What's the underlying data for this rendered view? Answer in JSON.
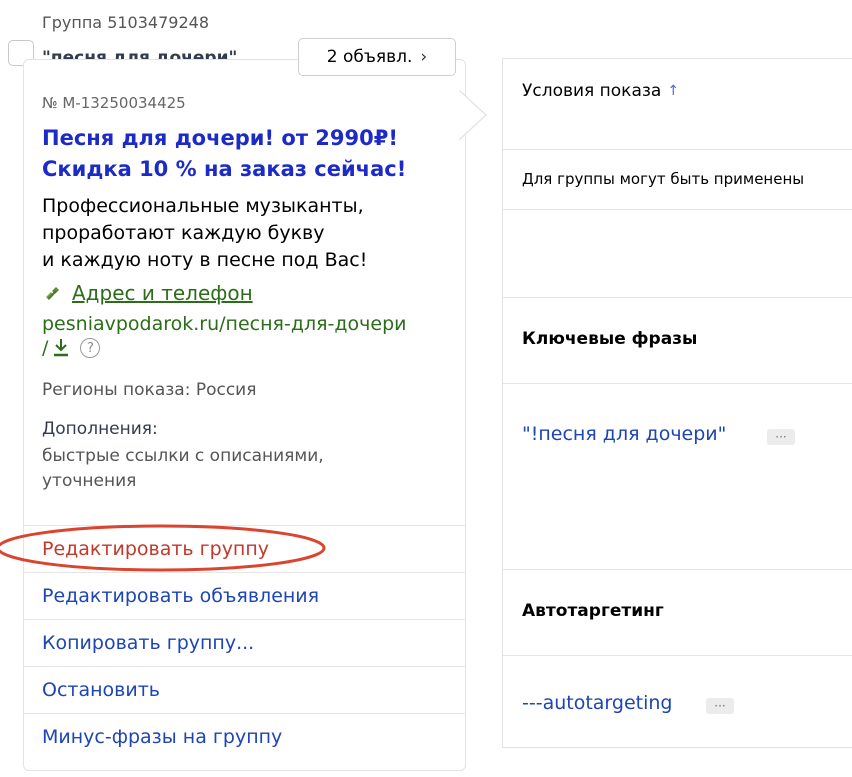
{
  "group": {
    "id_label": "Группа 5103479248",
    "name": "\"песня для дочери\"",
    "ads_count_label": "2 объявл.",
    "ads_count_chevron": "›"
  },
  "ad": {
    "number": "№ М-13250034425",
    "title_line1": "Песня для дочери! от 2990₽!",
    "title_line2": "Скидка 10 % на заказ сейчас!",
    "text_line1": "Профессиональные музыканты,",
    "text_line2": "проработают каждую букву",
    "text_line3": "и каждую ноту в песне под Вас!",
    "address_link": "Адрес и телефон",
    "url_line1": "pesniavpodarok.ru/песня-для-дочери",
    "url_line2": "/",
    "help_symbol": "?",
    "regions": "Регионы показа: Россия",
    "extras_title": "Дополнения:",
    "extras_line1": "быстрые ссылки с описаниями,",
    "extras_line2": "уточнения"
  },
  "menu": {
    "items": [
      {
        "label": "Редактировать группу"
      },
      {
        "label": "Редактировать объявления"
      },
      {
        "label": "Копировать группу..."
      },
      {
        "label": "Остановить"
      },
      {
        "label": "Минус-фразы на группу"
      }
    ]
  },
  "right_panel": {
    "conditions_header": "Условия показа",
    "sort_arrow": "↑",
    "group_note": "Для группы могут быть применены",
    "keywords_title": "Ключевые фразы",
    "keyword_phrase": "\"!песня для дочери\"",
    "more_label": "···",
    "autotargeting_title": "Автотаргетинг",
    "autotargeting_phrase": "---autotargeting"
  },
  "colors": {
    "title_blue": "#1d2bc6",
    "link_blue": "#1d45b4",
    "url_green": "#2b6d1a",
    "annotation_red": "#d9452f"
  },
  "icons": [
    "phone-icon",
    "vcard-download-icon",
    "help-icon",
    "chevron-right-icon",
    "sort-up-icon"
  ]
}
